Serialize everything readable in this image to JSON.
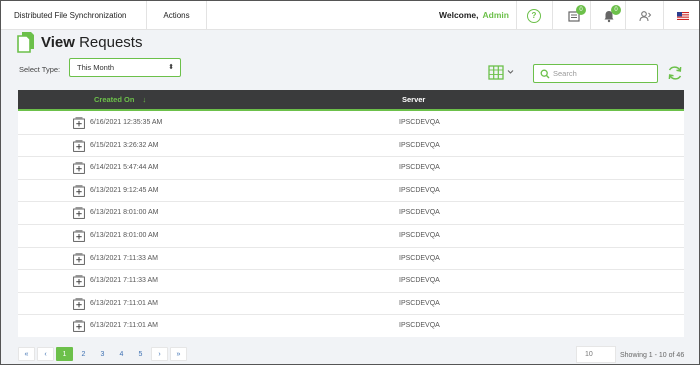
{
  "nav": {
    "app_name": "Distributed File Synchronization",
    "actions_label": "Actions",
    "welcome_label": "Welcome,",
    "user_name": "Admin",
    "help_label": "?",
    "messages_count": "0",
    "notifications_count": "0"
  },
  "page": {
    "title_bold": "View",
    "title_rest": " Requests"
  },
  "filter": {
    "select_label": "Select Type:",
    "selected_value": "This Month"
  },
  "search": {
    "placeholder": "Search"
  },
  "table": {
    "headers": {
      "created_on": "Created On",
      "sort_glyph": "↓",
      "server": "Server"
    },
    "rows": [
      {
        "created_on": "6/16/2021 12:35:35 AM",
        "server": "IPSCDEVQA"
      },
      {
        "created_on": "6/15/2021 3:26:32 AM",
        "server": "IPSCDEVQA"
      },
      {
        "created_on": "6/14/2021 5:47:44 AM",
        "server": "IPSCDEVQA"
      },
      {
        "created_on": "6/13/2021 9:12:45 AM",
        "server": "IPSCDEVQA"
      },
      {
        "created_on": "6/13/2021 8:01:00 AM",
        "server": "IPSCDEVQA"
      },
      {
        "created_on": "6/13/2021 8:01:00 AM",
        "server": "IPSCDEVQA"
      },
      {
        "created_on": "6/13/2021 7:11:33 AM",
        "server": "IPSCDEVQA"
      },
      {
        "created_on": "6/13/2021 7:11:33 AM",
        "server": "IPSCDEVQA"
      },
      {
        "created_on": "6/13/2021 7:11:01 AM",
        "server": "IPSCDEVQA"
      },
      {
        "created_on": "6/13/2021 7:11:01 AM",
        "server": "IPSCDEVQA"
      }
    ]
  },
  "pagination": {
    "first": "«",
    "prev": "‹",
    "pages": [
      "1",
      "2",
      "3",
      "4",
      "5"
    ],
    "current_page": "1",
    "next": "›",
    "last": "»",
    "page_size": "10",
    "showing_text": "Showing 1 - 10 of 46"
  },
  "colors": {
    "accent": "#6cc04a",
    "header_bg": "#3a3b3c",
    "link": "#3d70b2"
  },
  "icons": {
    "page": "documents-icon",
    "columns": "columns-icon",
    "search": "search-icon",
    "refresh": "refresh-icon",
    "messages": "inbox-icon",
    "notifications": "bell-icon",
    "user": "user-settings-icon",
    "language": "us-flag-icon",
    "row_expand": "plus-box-icon"
  }
}
